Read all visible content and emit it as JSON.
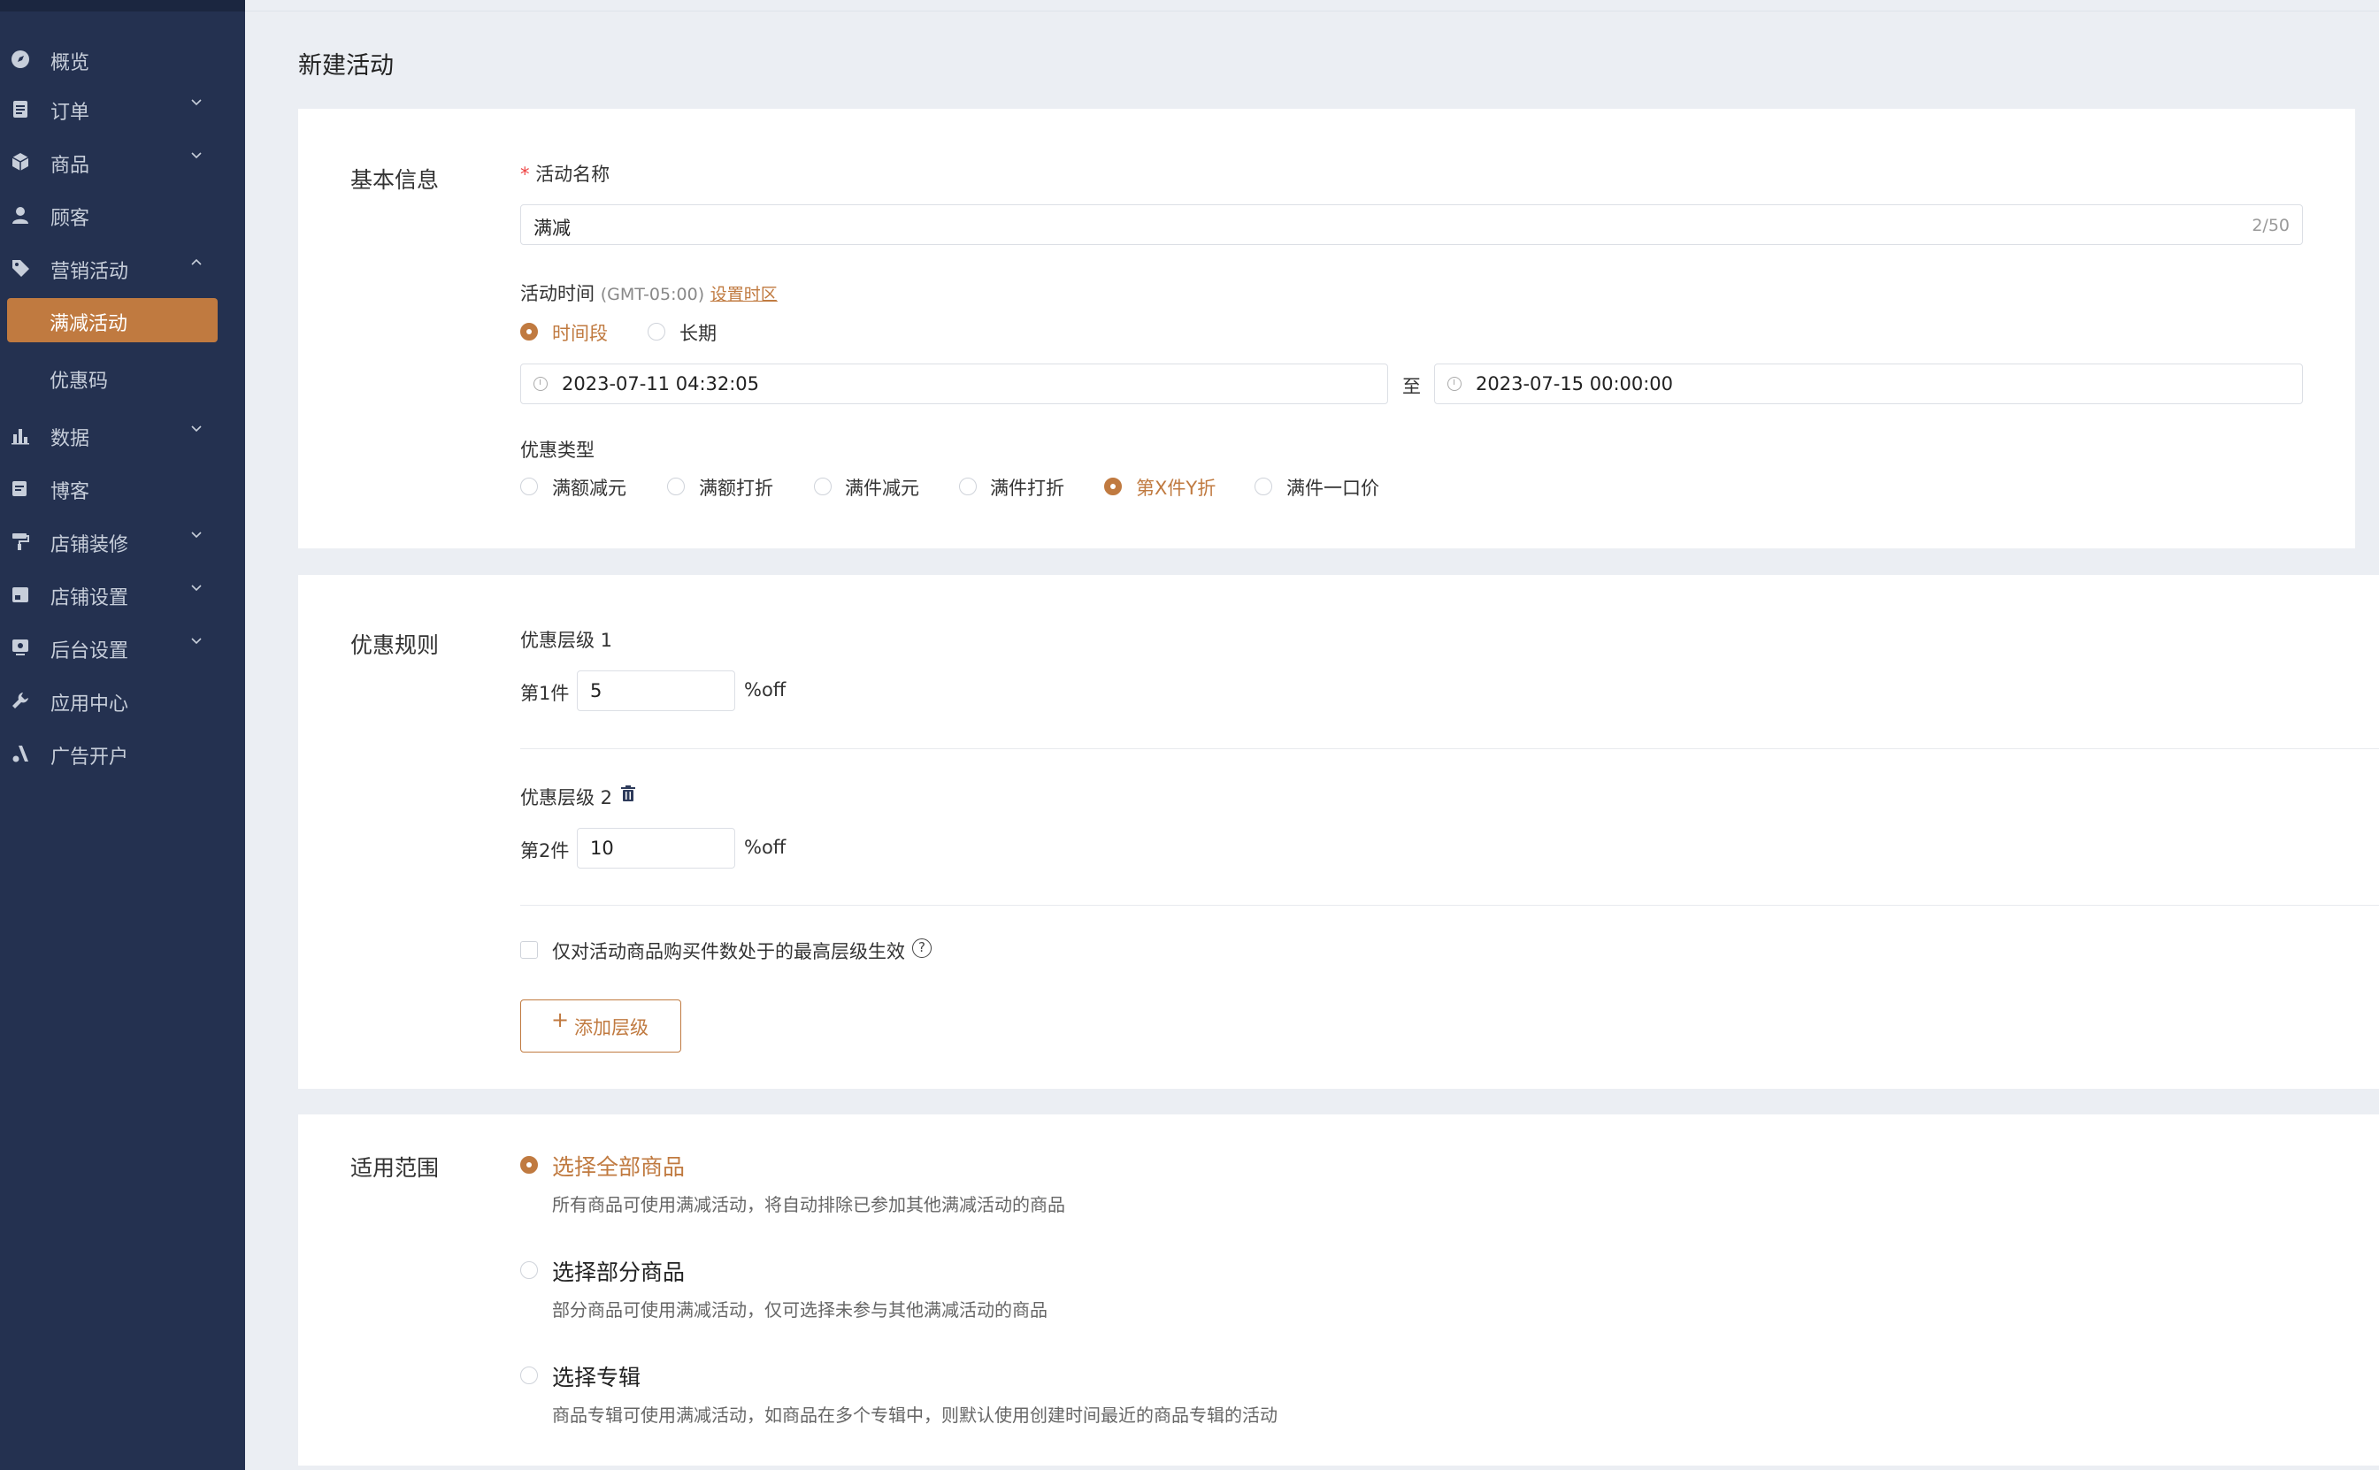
{
  "sidebar": {
    "items": [
      {
        "label": "概览",
        "icon": "compass-icon"
      },
      {
        "label": "订单",
        "icon": "clipboard-icon"
      },
      {
        "label": "商品",
        "icon": "box-icon"
      },
      {
        "label": "顾客",
        "icon": "user-icon"
      },
      {
        "label": "营销活动",
        "icon": "tag-icon"
      },
      {
        "label": "数据",
        "icon": "bar-chart-icon"
      },
      {
        "label": "博客",
        "icon": "edit-icon"
      },
      {
        "label": "店铺装修",
        "icon": "paint-roller-icon"
      },
      {
        "label": "店铺设置",
        "icon": "store-icon"
      },
      {
        "label": "后台设置",
        "icon": "monitor-icon"
      },
      {
        "label": "应用中心",
        "icon": "wrench-icon"
      },
      {
        "label": "广告开户",
        "icon": "ad-icon"
      }
    ],
    "sub_items": [
      {
        "label": "满减活动",
        "active": true
      },
      {
        "label": "优惠码",
        "active": false
      }
    ]
  },
  "page": {
    "title": "新建活动"
  },
  "basic": {
    "section_title": "基本信息",
    "name_required": "*",
    "name_label": "活动名称",
    "name_value": "满减",
    "name_count": "2/50",
    "time_label": "活动时间",
    "time_tz": "(GMT-05:00)",
    "time_tz_link": "设置时区",
    "time_mode_options": [
      "时间段",
      "长期"
    ],
    "time_mode_selected": "时间段",
    "start_time": "2023-07-11 04:32:05",
    "to_label": "至",
    "end_time": "2023-07-15 00:00:00",
    "discount_type_label": "优惠类型",
    "discount_types": [
      "满额减元",
      "满额打折",
      "满件减元",
      "满件打折",
      "第X件Y折",
      "满件一口价"
    ],
    "discount_type_selected": "第X件Y折"
  },
  "rules": {
    "section_title": "优惠规则",
    "tiers": [
      {
        "title": "优惠层级 1",
        "prefix": "第1件",
        "value": "5",
        "unit": "%off"
      },
      {
        "title": "优惠层级 2",
        "prefix": "第2件",
        "value": "10",
        "unit": "%off"
      }
    ],
    "checkbox_label": "仅对活动商品购买件数处于的最高层级生效",
    "help_glyph": "?",
    "add_tier_label": "添加层级"
  },
  "scope": {
    "section_title": "适用范围",
    "options": [
      {
        "title": "选择全部商品",
        "desc": "所有商品可使用满减活动，将自动排除已参加其他满减活动的商品",
        "selected": true
      },
      {
        "title": "选择部分商品",
        "desc": "部分商品可使用满减活动，仅可选择未参与其他满减活动的商品",
        "selected": false
      },
      {
        "title": "选择专辑",
        "desc": "商品专辑可使用满减活动，如商品在多个专辑中，则默认使用创建时间最近的商品专辑的活动",
        "selected": false
      }
    ]
  },
  "colors": {
    "accent": "#c07a40",
    "sidebar_bg": "#243150",
    "page_bg": "#ebeef3"
  }
}
